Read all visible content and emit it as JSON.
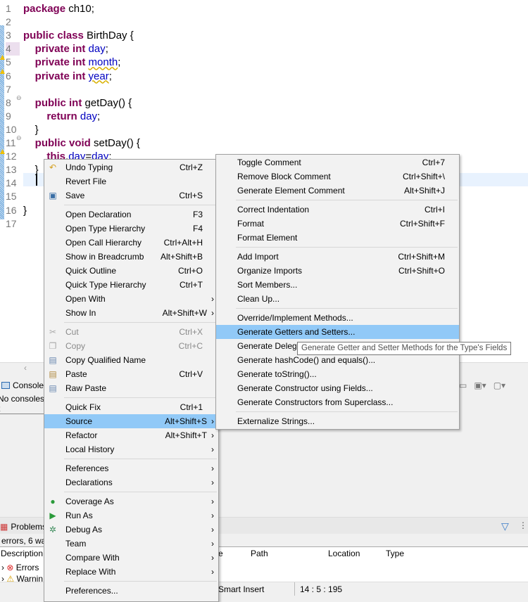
{
  "editor": {
    "line_numbers": [
      "1",
      "2",
      "3",
      "4",
      "5",
      "6",
      "7",
      "8",
      "9",
      "10",
      "11",
      "12",
      "13",
      "14",
      "15",
      "16",
      "17"
    ],
    "lines": [
      [
        {
          "t": "package",
          "c": "kw"
        },
        {
          "t": " ch10;"
        }
      ],
      [],
      [
        {
          "t": "public class",
          "c": "kw"
        },
        {
          "t": " BirthDay {"
        }
      ],
      [
        {
          "t": "    private int",
          "c": "kw"
        },
        {
          "t": " "
        },
        {
          "t": "day",
          "c": "fld"
        },
        {
          "t": ";"
        }
      ],
      [
        {
          "t": "    private int",
          "c": "kw"
        },
        {
          "t": " "
        },
        {
          "t": "month",
          "c": "fld warnu"
        },
        {
          "t": ";"
        }
      ],
      [
        {
          "t": "    private int",
          "c": "kw"
        },
        {
          "t": " "
        },
        {
          "t": "year",
          "c": "fld warnu"
        },
        {
          "t": ";"
        }
      ],
      [],
      [
        {
          "t": "    public int",
          "c": "kw"
        },
        {
          "t": " getDay() {"
        }
      ],
      [
        {
          "t": "        return",
          "c": "kw"
        },
        {
          "t": " "
        },
        {
          "t": "day",
          "c": "fld"
        },
        {
          "t": ";"
        }
      ],
      [
        {
          "t": "    }"
        }
      ],
      [
        {
          "t": "    public void",
          "c": "kw"
        },
        {
          "t": " setDay() {"
        }
      ],
      [
        {
          "t": "        this",
          "c": "kw"
        },
        {
          "t": "."
        },
        {
          "t": "day",
          "c": "fld"
        },
        {
          "t": "="
        },
        {
          "t": "day",
          "c": "fld"
        },
        {
          "t": ";"
        }
      ],
      [
        {
          "t": "    }"
        }
      ],
      [],
      [],
      [
        {
          "t": "}"
        }
      ],
      []
    ]
  },
  "console": {
    "tab_label": "Console",
    "message": "No consoles t"
  },
  "problems": {
    "tab_label": "Problems",
    "summary": "errors, 6 wa",
    "columns": [
      "Description",
      "e",
      "Path",
      "Location",
      "Type"
    ],
    "rows": [
      "Errors",
      "Warnin"
    ]
  },
  "status": {
    "insert_mode": "Smart Insert",
    "position": "14 : 5 : 195"
  },
  "context_menu": [
    {
      "label": "Undo Typing",
      "shortcut": "Ctrl+Z",
      "icon": "undo-icon"
    },
    {
      "label": "Revert File"
    },
    {
      "label": "Save",
      "shortcut": "Ctrl+S",
      "icon": "save-icon"
    },
    {
      "sep": true
    },
    {
      "label": "Open Declaration",
      "shortcut": "F3"
    },
    {
      "label": "Open Type Hierarchy",
      "shortcut": "F4"
    },
    {
      "label": "Open Call Hierarchy",
      "shortcut": "Ctrl+Alt+H"
    },
    {
      "label": "Show in Breadcrumb",
      "shortcut": "Alt+Shift+B"
    },
    {
      "label": "Quick Outline",
      "shortcut": "Ctrl+O"
    },
    {
      "label": "Quick Type Hierarchy",
      "shortcut": "Ctrl+T"
    },
    {
      "label": "Open With",
      "submenu": true
    },
    {
      "label": "Show In",
      "shortcut": "Alt+Shift+W",
      "submenu": true
    },
    {
      "sep": true
    },
    {
      "label": "Cut",
      "shortcut": "Ctrl+X",
      "disabled": true,
      "icon": "cut-icon"
    },
    {
      "label": "Copy",
      "shortcut": "Ctrl+C",
      "disabled": true,
      "icon": "copy-icon"
    },
    {
      "label": "Copy Qualified Name",
      "icon": "copy-qualified-icon"
    },
    {
      "label": "Paste",
      "shortcut": "Ctrl+V",
      "icon": "paste-icon"
    },
    {
      "label": "Raw Paste",
      "icon": "raw-paste-icon"
    },
    {
      "sep": true
    },
    {
      "label": "Quick Fix",
      "shortcut": "Ctrl+1"
    },
    {
      "label": "Source",
      "shortcut": "Alt+Shift+S",
      "submenu": true,
      "selected": true
    },
    {
      "label": "Refactor",
      "shortcut": "Alt+Shift+T",
      "submenu": true
    },
    {
      "label": "Local History",
      "submenu": true
    },
    {
      "sep": true
    },
    {
      "label": "References",
      "submenu": true
    },
    {
      "label": "Declarations",
      "submenu": true
    },
    {
      "sep": true
    },
    {
      "label": "Coverage As",
      "submenu": true,
      "icon": "coverage-icon"
    },
    {
      "label": "Run As",
      "submenu": true,
      "icon": "run-icon"
    },
    {
      "label": "Debug As",
      "submenu": true,
      "icon": "debug-icon"
    },
    {
      "label": "Team",
      "submenu": true
    },
    {
      "label": "Compare With",
      "submenu": true
    },
    {
      "label": "Replace With",
      "submenu": true
    },
    {
      "sep": true
    },
    {
      "label": "Preferences..."
    }
  ],
  "source_submenu": [
    {
      "label": "Toggle Comment",
      "shortcut": "Ctrl+7"
    },
    {
      "label": "Remove Block Comment",
      "shortcut": "Ctrl+Shift+\\"
    },
    {
      "label": "Generate Element Comment",
      "shortcut": "Alt+Shift+J"
    },
    {
      "sep": true
    },
    {
      "label": "Correct Indentation",
      "shortcut": "Ctrl+I"
    },
    {
      "label": "Format",
      "shortcut": "Ctrl+Shift+F"
    },
    {
      "label": "Format Element"
    },
    {
      "sep": true
    },
    {
      "label": "Add Import",
      "shortcut": "Ctrl+Shift+M"
    },
    {
      "label": "Organize Imports",
      "shortcut": "Ctrl+Shift+O"
    },
    {
      "label": "Sort Members..."
    },
    {
      "label": "Clean Up..."
    },
    {
      "sep": true
    },
    {
      "label": "Override/Implement Methods..."
    },
    {
      "label": "Generate Getters and Setters...",
      "selected": true
    },
    {
      "label": "Generate Delegate Methods..."
    },
    {
      "label": "Generate hashCode() and equals()..."
    },
    {
      "label": "Generate toString()..."
    },
    {
      "label": "Generate Constructor using Fields..."
    },
    {
      "label": "Generate Constructors from Superclass..."
    },
    {
      "sep": true
    },
    {
      "label": "Externalize Strings..."
    }
  ],
  "tooltip": "Generate Getter and Setter Methods for the Type's Fields",
  "colors": {
    "selection": "#91c9f7",
    "keyword": "#7f0055",
    "field": "#0000c0"
  }
}
